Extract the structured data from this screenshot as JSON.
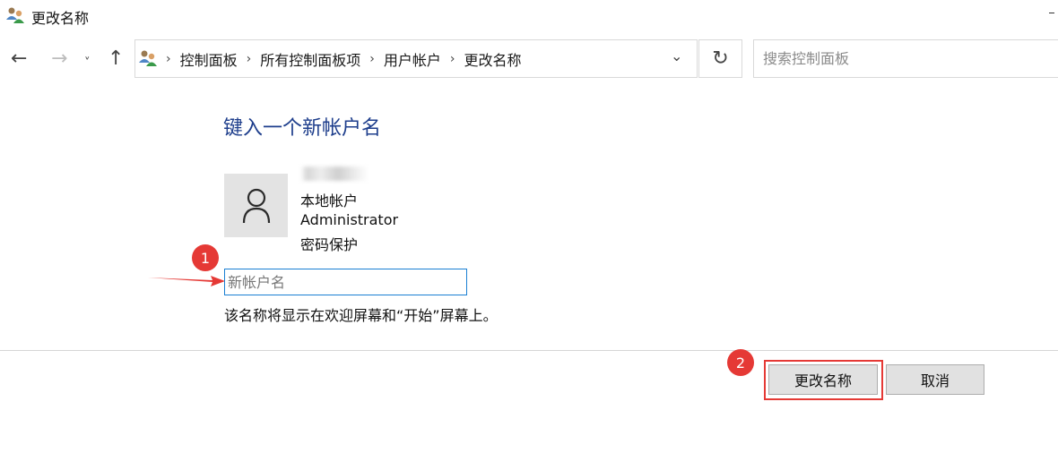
{
  "window": {
    "title": "更改名称",
    "icon": "user-accounts-icon"
  },
  "nav": {
    "back_icon": "←",
    "forward_icon": "→",
    "recent_icon": "˅",
    "up_icon": "↑"
  },
  "address": {
    "breadcrumbs": [
      "控制面板",
      "所有控制面板项",
      "用户帐户",
      "更改名称"
    ],
    "separator": "›",
    "dropdown_icon": "⌄",
    "refresh_icon": "↻"
  },
  "search": {
    "placeholder": "搜索控制面板"
  },
  "main": {
    "heading": "键入一个新帐户名",
    "account": {
      "type": "本地帐户",
      "group": "Administrator",
      "password_status": "密码保护"
    },
    "new_name_placeholder": "新帐户名",
    "description": "该名称将显示在欢迎屏幕和“开始”屏幕上。"
  },
  "annotations": {
    "step1": "1",
    "step2": "2",
    "color": "#e53935"
  },
  "buttons": {
    "rename": "更改名称",
    "cancel": "取消"
  },
  "colors": {
    "heading": "#1e3e8c",
    "input_focus_border": "#1a7fd3"
  }
}
